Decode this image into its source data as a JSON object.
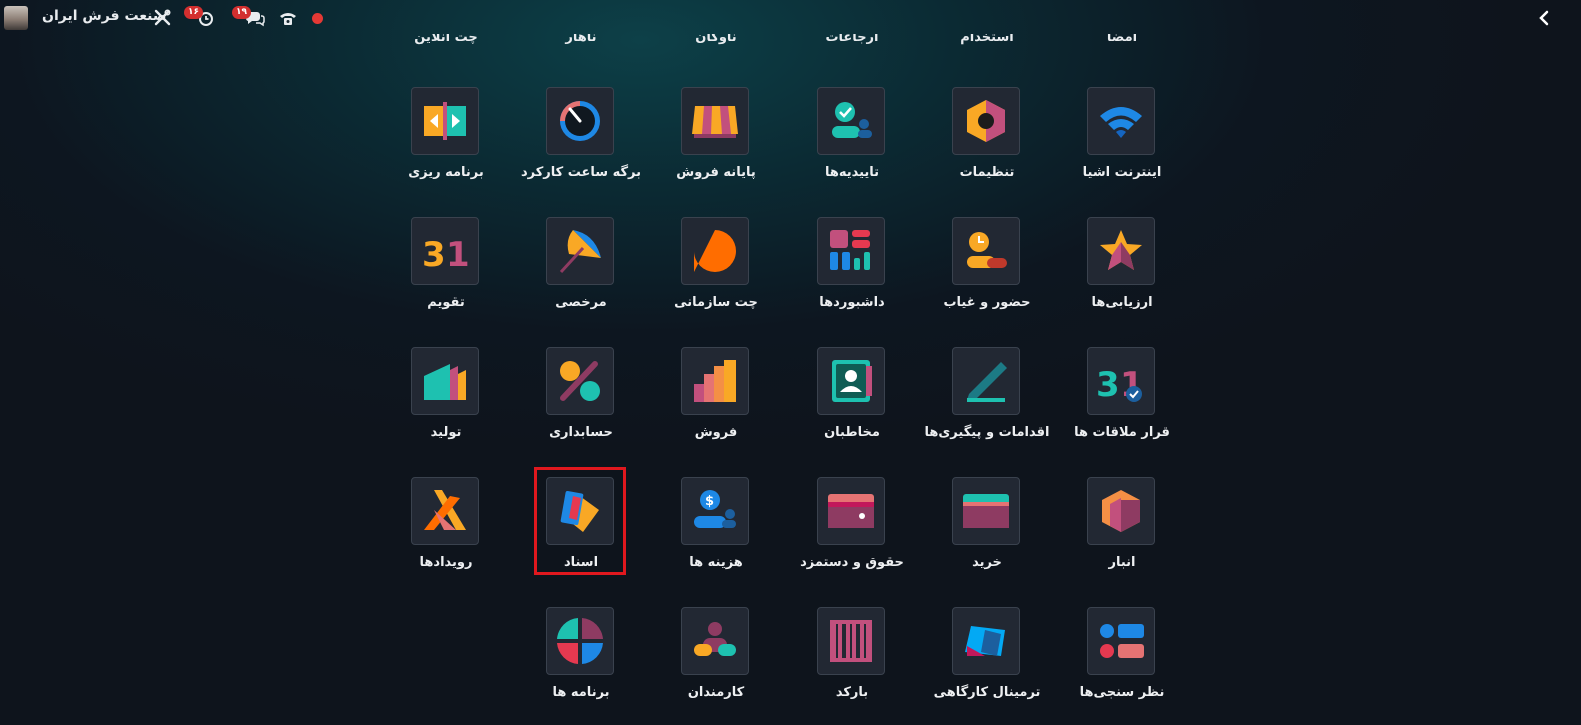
{
  "topbar": {
    "company_name": "صنعت فرش ایران",
    "activity_count": "۱۶",
    "messages_count": "۱۹",
    "icons": [
      "avatar",
      "tools-icon",
      "clock-icon",
      "chat-icon",
      "phone-icon",
      "record-icon",
      "chevron-right-icon"
    ],
    "record_color": "#e53935"
  },
  "top_row_labels": [
    "امضا",
    "استخدام",
    "ارجاعات",
    "ناوگان",
    "ناهار",
    "چت آنلاین"
  ],
  "apps": [
    {
      "label": "اینترنت اشیا",
      "icon": "wifi-icon"
    },
    {
      "label": "تنظیمات",
      "icon": "settings-hex-icon"
    },
    {
      "label": "تاییدیه‌ها",
      "icon": "approvals-icon"
    },
    {
      "label": "پایانه فروش",
      "icon": "shop-awning-icon"
    },
    {
      "label": "برگه ساعت کارکرد",
      "icon": "timesheet-dial-icon"
    },
    {
      "label": "برنامه ریزی",
      "icon": "planning-icon"
    },
    {
      "label": "ارزیابی‌ها",
      "icon": "star-icon"
    },
    {
      "label": "حضور و غیاب",
      "icon": "attendance-icon"
    },
    {
      "label": "داشبوردها",
      "icon": "dashboard-icon"
    },
    {
      "label": "چت سازمانی",
      "icon": "chat-bubble-icon"
    },
    {
      "label": "مرخصی",
      "icon": "umbrella-icon"
    },
    {
      "label": "تقویم",
      "icon": "calendar-31-icon"
    },
    {
      "label": "قرار ملاقات ها",
      "icon": "appointment-icon"
    },
    {
      "label": "اقدامات و پیگیری‌ها",
      "icon": "pencil-icon"
    },
    {
      "label": "مخاطبان",
      "icon": "contacts-icon"
    },
    {
      "label": "فروش",
      "icon": "bars-chart-icon"
    },
    {
      "label": "حسابداری",
      "icon": "percent-icon"
    },
    {
      "label": "تولید",
      "icon": "factory-icon"
    },
    {
      "label": "انبار",
      "icon": "box-icon"
    },
    {
      "label": "خرید",
      "icon": "purchase-card-icon"
    },
    {
      "label": "حقوق و دستمزد",
      "icon": "payroll-icon"
    },
    {
      "label": "هزینه ها",
      "icon": "expenses-icon"
    },
    {
      "label": "اسناد",
      "icon": "documents-icon",
      "highlighted": true
    },
    {
      "label": "رویدادها",
      "icon": "events-icon"
    },
    {
      "label": "نظر سنجی‌ها",
      "icon": "survey-icon"
    },
    {
      "label": "ترمینال کارگاهی",
      "icon": "terminal-icon"
    },
    {
      "label": "بارکد",
      "icon": "barcode-icon"
    },
    {
      "label": "کارمندان",
      "icon": "employees-icon"
    },
    {
      "label": "برنامه ها",
      "icon": "apps-icon"
    }
  ],
  "highlight_color": "#e0181e"
}
